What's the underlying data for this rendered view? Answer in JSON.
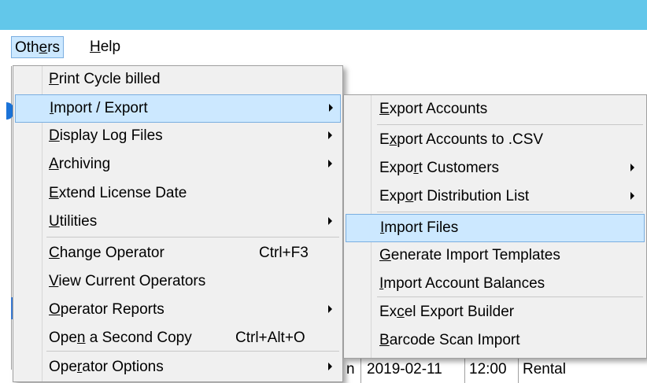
{
  "menubar": {
    "others": {
      "pre": "Oth",
      "acc": "e",
      "post": "rs"
    },
    "help": {
      "pre": "",
      "acc": "H",
      "post": "elp"
    }
  },
  "background": {
    "row_date": "2019-02-11",
    "row_time": "12:00",
    "row_type": "Rental",
    "row_partial": "n"
  },
  "others_menu": [
    {
      "pre": "",
      "acc": "P",
      "post": "rint Cycle billed",
      "shortcut": "",
      "submenu": false
    },
    {
      "pre": "",
      "acc": "I",
      "post": "mport / Export",
      "shortcut": "",
      "submenu": true
    },
    {
      "pre": "",
      "acc": "D",
      "post": "isplay Log Files",
      "shortcut": "",
      "submenu": true
    },
    {
      "pre": "",
      "acc": "A",
      "post": "rchiving",
      "shortcut": "",
      "submenu": true
    },
    {
      "pre": "",
      "acc": "E",
      "post": "xtend License Date",
      "shortcut": "",
      "submenu": false
    },
    {
      "pre": "",
      "acc": "U",
      "post": "tilities",
      "shortcut": "",
      "submenu": true
    },
    {
      "pre": "",
      "acc": "C",
      "post": "hange Operator",
      "shortcut": "Ctrl+F3",
      "submenu": false
    },
    {
      "pre": "",
      "acc": "V",
      "post": "iew Current Operators",
      "shortcut": "",
      "submenu": false
    },
    {
      "pre": "",
      "acc": "O",
      "post": "perator Reports",
      "shortcut": "",
      "submenu": true
    },
    {
      "pre": "Ope",
      "acc": "n",
      "post": " a Second Copy",
      "shortcut": "Ctrl+Alt+O",
      "submenu": false
    },
    {
      "pre": "Ope",
      "acc": "r",
      "post": "ator Options",
      "shortcut": "",
      "submenu": true
    }
  ],
  "import_export_menu": [
    {
      "pre": "",
      "acc": "E",
      "post": "xport Accounts",
      "submenu": false
    },
    {
      "pre": "E",
      "acc": "x",
      "post": "port Accounts to .CSV",
      "submenu": false
    },
    {
      "pre": "Expo",
      "acc": "r",
      "post": "t Customers",
      "submenu": true
    },
    {
      "pre": "Exp",
      "acc": "o",
      "post": "rt Distribution List",
      "submenu": true
    },
    {
      "pre": "",
      "acc": "I",
      "post": "mport Files",
      "submenu": false
    },
    {
      "pre": "",
      "acc": "G",
      "post": "enerate Import Templates",
      "submenu": false
    },
    {
      "pre": "",
      "acc": "I",
      "post": "mport Account Balances",
      "submenu": false
    },
    {
      "pre": "Ex",
      "acc": "c",
      "post": "el Export Builder",
      "submenu": false
    },
    {
      "pre": "",
      "acc": "B",
      "post": "arcode Scan Import",
      "submenu": false
    }
  ]
}
